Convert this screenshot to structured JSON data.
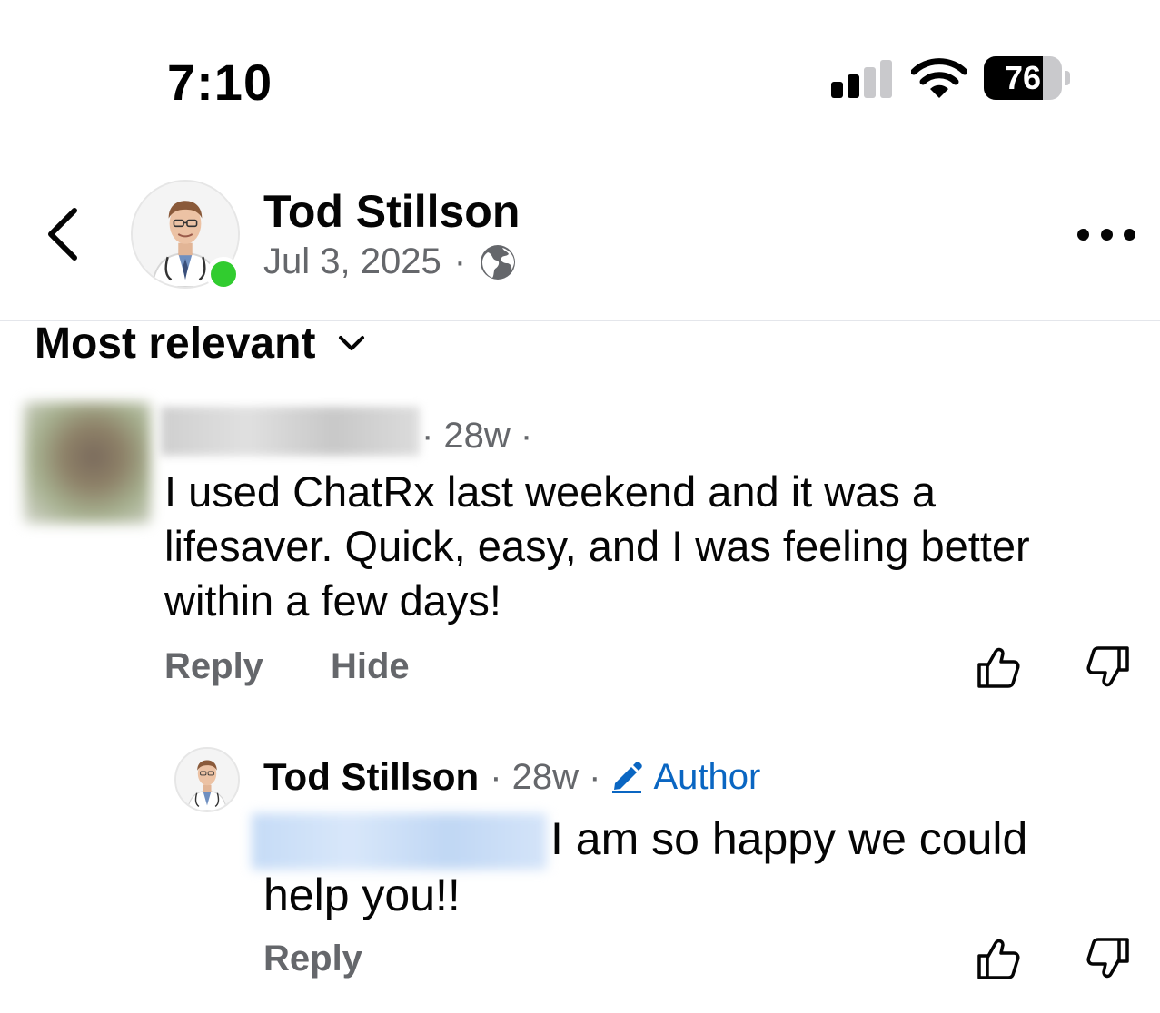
{
  "status_bar": {
    "time": "7:10",
    "battery_percent": 76,
    "battery_label": "76"
  },
  "header": {
    "author_name": "Tod Stillson",
    "post_date": "Jul 3, 2025",
    "separator": "·",
    "audience_icon": "globe-icon",
    "online": true
  },
  "sort": {
    "label": "Most relevant"
  },
  "comments": [
    {
      "meta": "· 28w ·",
      "text": "I used ChatRx last weekend and it was a lifesaver. Quick, easy, and I was feeling better within a few days!",
      "actions": {
        "reply": "Reply",
        "hide": "Hide"
      }
    }
  ],
  "reply": {
    "author_name": "Tod Stillson",
    "meta": "· 28w ·",
    "badge": "Author",
    "text": "I am so happy we could help you!!",
    "reply_label": "Reply"
  },
  "colors": {
    "primary_text": "#050505",
    "secondary_text": "#65676b",
    "author_blue": "#0a66c2",
    "online_green": "#31cc2f"
  }
}
